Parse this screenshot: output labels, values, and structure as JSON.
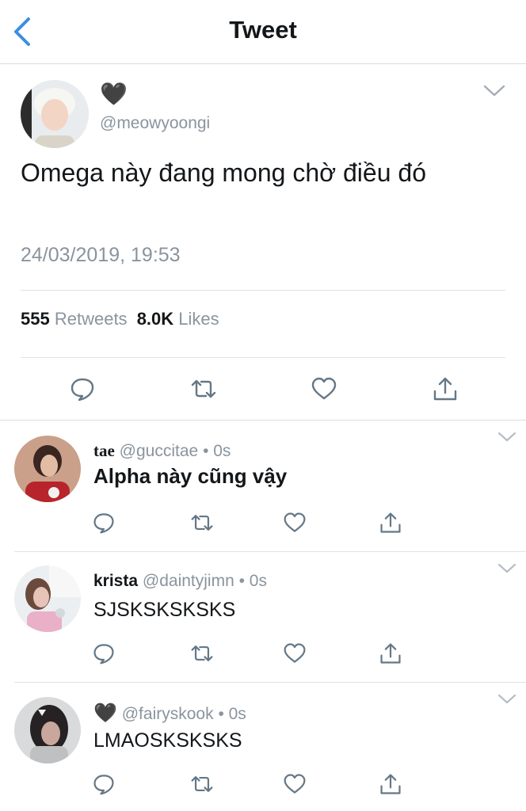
{
  "nav": {
    "title": "Tweet",
    "back_icon": "chevron-left-icon"
  },
  "tweet": {
    "display_name": "🖤",
    "handle": "@meowyoongi",
    "text": "Omega này đang mong chờ điều đó",
    "timestamp": "24/03/2019, 19:53",
    "retweets_count": "555",
    "retweets_label": "Retweets",
    "likes_count": "8.0K",
    "likes_label": "Likes",
    "actions": [
      "reply-icon",
      "retweet-icon",
      "like-icon",
      "share-icon"
    ]
  },
  "replies": [
    {
      "name": "tae",
      "handle": "@guccitae",
      "time": "0s",
      "text": "Alpha này cũng vậy"
    },
    {
      "name": "krista",
      "handle": "@daintyjimn",
      "time": "0s",
      "text": "SJSKSKSKSKS"
    },
    {
      "name": "🖤",
      "handle": "@fairyskook",
      "time": "0s",
      "text": "LMAOSKSKSKS"
    }
  ],
  "colors": {
    "accent": "#1da1f2",
    "muted": "#8a949e",
    "divider": "#dfe3e7"
  }
}
